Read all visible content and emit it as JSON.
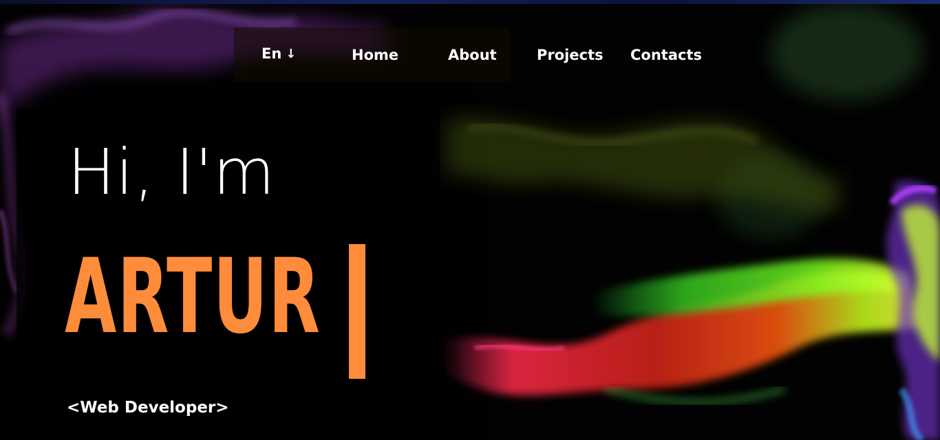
{
  "nav": {
    "language": "En",
    "language_arrow": "↓",
    "items": [
      {
        "label": "Home"
      },
      {
        "label": "About"
      },
      {
        "label": "Projects"
      },
      {
        "label": "Contacts"
      }
    ]
  },
  "hero": {
    "greeting": "Hi, I'm",
    "name": "ARTUR",
    "role": "<Web Developer>"
  },
  "colors": {
    "accent": "#ff8c3a",
    "text": "#ffffff",
    "background": "#000000"
  }
}
